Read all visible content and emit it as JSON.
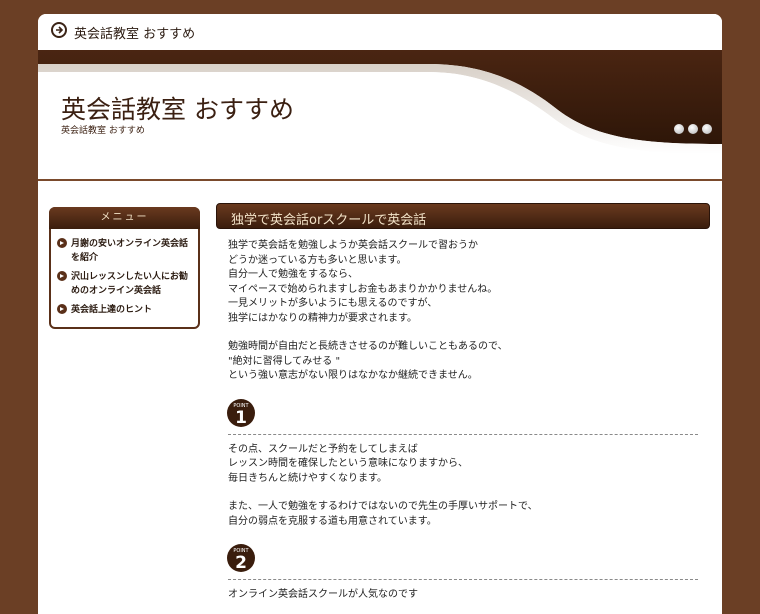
{
  "topbar": {
    "site_name": "英会話教室 おすすめ"
  },
  "header": {
    "title": "英会話教室 おすすめ",
    "subtitle": "英会話教室 おすすめ"
  },
  "sidebar": {
    "heading": "メニュー",
    "items": [
      {
        "label": "月謝の安いオンライン英会話を紹介"
      },
      {
        "label": "沢山レッスンしたい人にお勧めのオンライン英会話"
      },
      {
        "label": "英会話上達のヒント"
      }
    ]
  },
  "main": {
    "heading": "独学で英会話orスクールで英会話",
    "paragraphs": [
      [
        "独学で英会話を勉強しようか英会話スクールで習おうか",
        "どうか迷っている方も多いと思います。",
        "自分一人で勉強をするなら、",
        "マイペースで始められますしお金もあまりかかりませんね。",
        "一見メリットが多いようにも思えるのですが、",
        "独学にはかなりの精神力が要求されます。"
      ],
      [
        "勉強時間が自由だと長続きさせるのが難しいこともあるので、",
        "\"絶対に習得してみせる \"",
        "という強い意志がない限りはなかなか継続できません。"
      ]
    ],
    "point1": {
      "label": "POINT",
      "number": "1",
      "paragraphs": [
        [
          "その点、スクールだと予約をしてしまえば",
          "レッスン時間を確保したという意味になりますから、",
          "毎日きちんと続けやすくなります。"
        ],
        [
          "また、一人で勉強をするわけではないので先生の手厚いサポートで、",
          "自分の弱点を克服する道も用意されています。"
        ]
      ]
    },
    "point2": {
      "label": "POINT",
      "number": "2",
      "partial_text": "オンライン英会話スクールが人気なのです"
    }
  },
  "colors": {
    "background": "#6b3f25",
    "band_dark": "#3a1d0d",
    "accent_text": "#f3e3c8"
  }
}
